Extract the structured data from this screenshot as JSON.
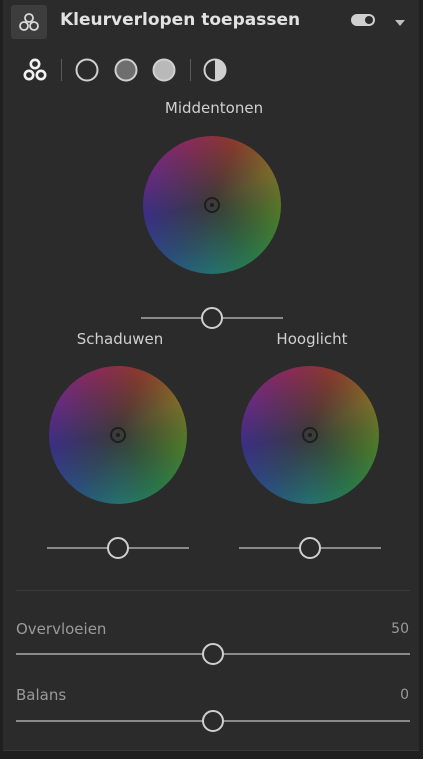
{
  "panel": {
    "title": "Kleurverlopen toepassen",
    "icon": "color-grading-icon",
    "enabled": true
  },
  "modes": [
    {
      "name": "3-way",
      "icon": "three-circles-icon",
      "selected": true
    },
    {
      "name": "shadows",
      "icon": "circle-outline-icon"
    },
    {
      "name": "midtones",
      "icon": "circle-gray-icon"
    },
    {
      "name": "highlights",
      "icon": "circle-light-icon"
    },
    {
      "name": "global",
      "icon": "half-circle-icon"
    }
  ],
  "wheels": {
    "midtones": {
      "label": "Middentonen",
      "luminance": 0
    },
    "shadows": {
      "label": "Schaduwen",
      "luminance": 0
    },
    "highlights": {
      "label": "Hooglicht",
      "luminance": 0
    }
  },
  "sliders": {
    "blending": {
      "label": "Overvloeien",
      "value": "50",
      "fraction": 0.5
    },
    "balance": {
      "label": "Balans",
      "value": "0",
      "fraction": 0.5
    }
  },
  "colors": {
    "panel_bg": "#2b2b2b",
    "text": "#dcdcdc",
    "muted_text": "#9a9a9a"
  }
}
